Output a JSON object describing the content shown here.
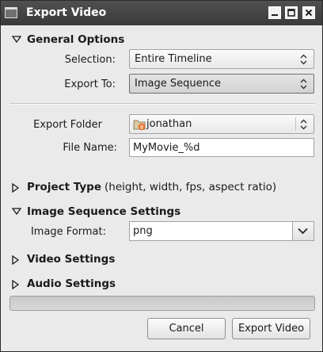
{
  "window": {
    "title": "Export Video",
    "icon": "window-icon",
    "controls": [
      "minimize-icon",
      "maximize-icon",
      "close-icon"
    ]
  },
  "general": {
    "header": "General Options",
    "expanded": true,
    "selection_label": "Selection:",
    "selection_value": "Entire Timeline",
    "export_to_label": "Export To:",
    "export_to_value": "Image Sequence",
    "export_folder_label": "Export Folder",
    "export_folder_value": "jonathan",
    "file_name_label": "File Name:",
    "file_name_value": "MyMovie_%d"
  },
  "project_type": {
    "header": "Project Type",
    "subtitle": "(height, width, fps, aspect ratio)",
    "expanded": false
  },
  "image_sequence": {
    "header": "Image Sequence Settings",
    "expanded": true,
    "image_format_label": "Image Format:",
    "image_format_value": "png"
  },
  "video_settings": {
    "header": "Video Settings",
    "expanded": false
  },
  "audio_settings": {
    "header": "Audio Settings",
    "expanded": false
  },
  "progress": {
    "value": 0
  },
  "buttons": {
    "cancel": "Cancel",
    "export": "Export Video"
  },
  "colors": {
    "titlebar": "#3a3a3a",
    "folder_accent": "#e8661e",
    "background": "#eaeaea"
  }
}
